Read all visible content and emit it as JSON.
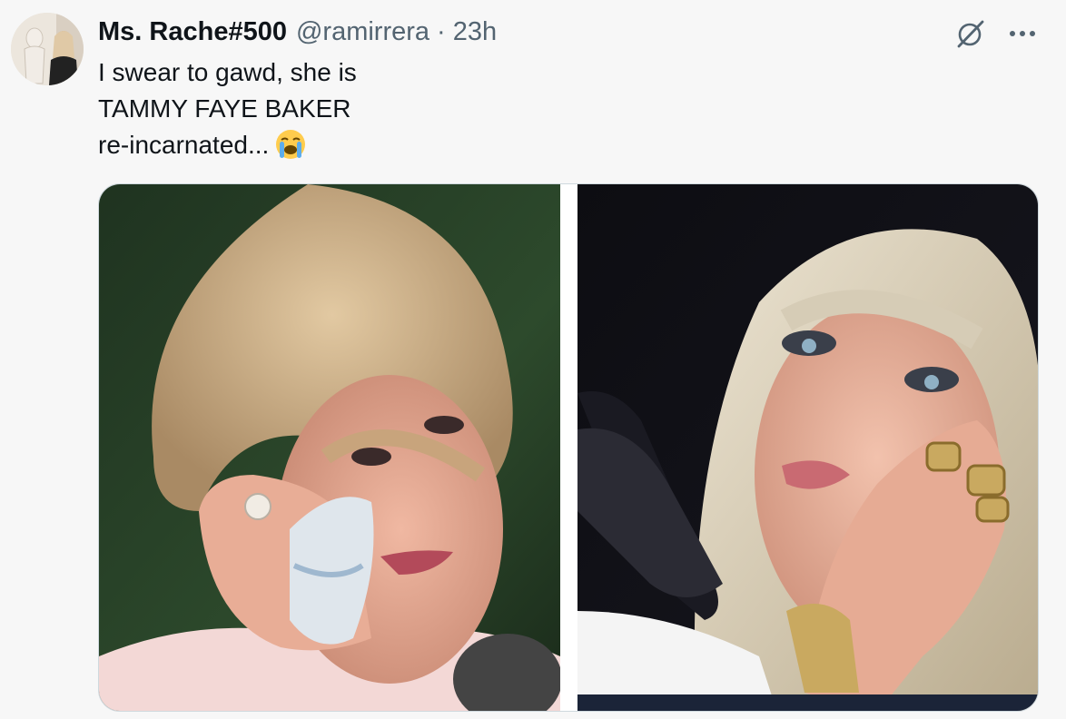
{
  "tweet": {
    "display_name": "Ms. Rache#500",
    "handle": "@ramirrera",
    "separator": "·",
    "time": "23h",
    "text_lines": [
      "I swear to gawd, she is",
      "TAMMY FAYE BAKER",
      "re-incarnated..."
    ],
    "emoji": "loudly-crying-face-emoji",
    "actions": {
      "grok": "grok-icon",
      "more": "more-options-icon"
    },
    "media": [
      {
        "kind": "photo",
        "position": "left",
        "description_icon": "crying-woman-tissue-photo"
      },
      {
        "kind": "photo",
        "position": "right",
        "description_icon": "crying-woman-rings-photo"
      }
    ]
  },
  "colors": {
    "background": "#f7f7f7",
    "text": "#0f1419",
    "secondary_text": "#536471",
    "media_border": "#cfd9de"
  }
}
